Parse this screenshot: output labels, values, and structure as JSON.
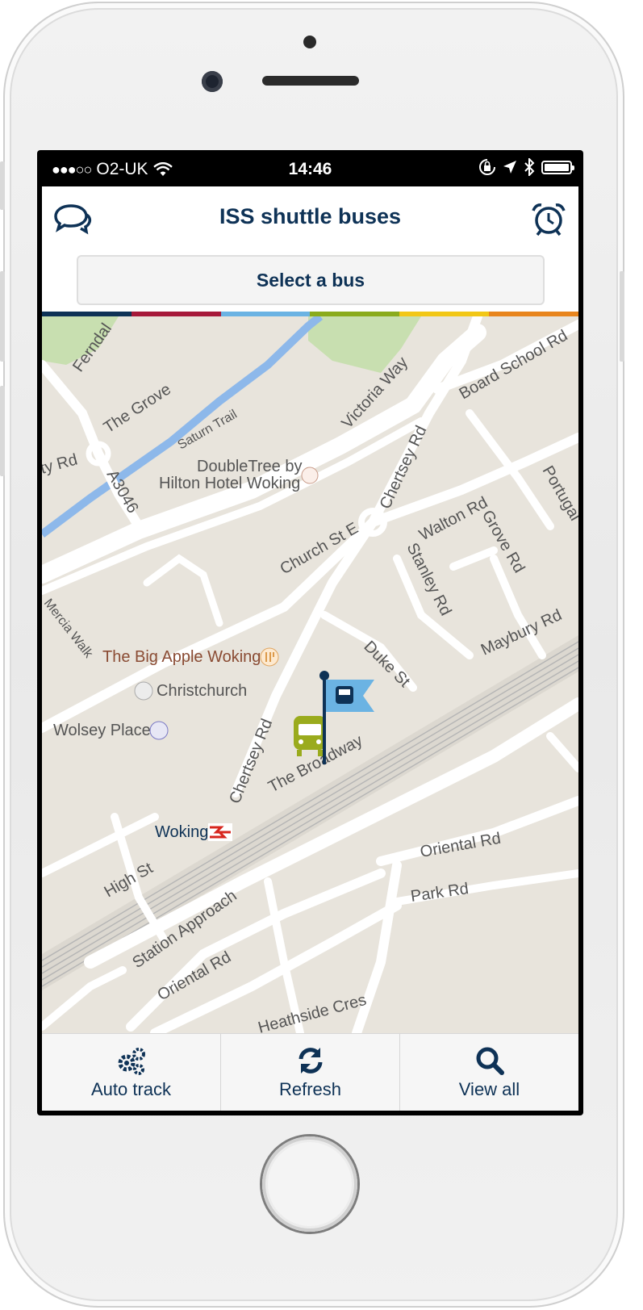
{
  "status_bar": {
    "carrier": "O2-UK",
    "time": "14:46",
    "signal_dots": "●●●○○"
  },
  "header": {
    "title": "ISS shuttle buses",
    "left_icon": "chat-bubbles-icon",
    "right_icon": "alarm-clock-icon"
  },
  "select_bus": {
    "label": "Select a bus"
  },
  "stripe_colors": [
    "#0e3256",
    "#a6193a",
    "#6bb3e3",
    "#8aab1c",
    "#f2c716",
    "#e8851d"
  ],
  "map": {
    "labels": {
      "ferndale": "Ferndal",
      "the_grove": "The Grove",
      "saturn_trail": "Saturn Trail",
      "victoria_way": "Victoria Way",
      "board_school_rd": "Board School Rd",
      "ty_rd": "ty Rd",
      "a3046": "A3046",
      "doubletree_1": "DoubleTree by",
      "doubletree_2": "Hilton Hotel Woking",
      "chertsey_rd_top": "Chertsey Rd",
      "portugal": "Portugal",
      "walton_rd": "Walton Rd",
      "grove_rd": "Grove Rd",
      "church_st_e": "Church St E",
      "stanley_rd": "Stanley Rd",
      "mercia_walk": "Mercia Walk",
      "maybury_rd": "Maybury Rd",
      "big_apple": "The Big Apple Woking",
      "duke_st": "Duke St",
      "christchurch": "Christchurch",
      "wolsey_place": "Wolsey Place",
      "chertsey_rd_bottom": "Chertsey Rd",
      "the_broadway": "The Broadway",
      "woking": "Woking",
      "oriental_rd_top": "Oriental Rd",
      "high_st": "High St",
      "park_rd": "Park Rd",
      "station_approach": "Station Approach",
      "oriental_rd_bottom": "Oriental Rd",
      "heathside_cres": "Heathside Cres"
    },
    "colors": {
      "bus_marker": "#9aab1d",
      "flag": "#6bb3e3",
      "flag_pole": "#0e3256",
      "water": "#8db8ea"
    }
  },
  "tabs": [
    {
      "label": "Auto track",
      "icon": "gears-icon"
    },
    {
      "label": "Refresh",
      "icon": "refresh-icon"
    },
    {
      "label": "View all",
      "icon": "search-icon"
    }
  ]
}
